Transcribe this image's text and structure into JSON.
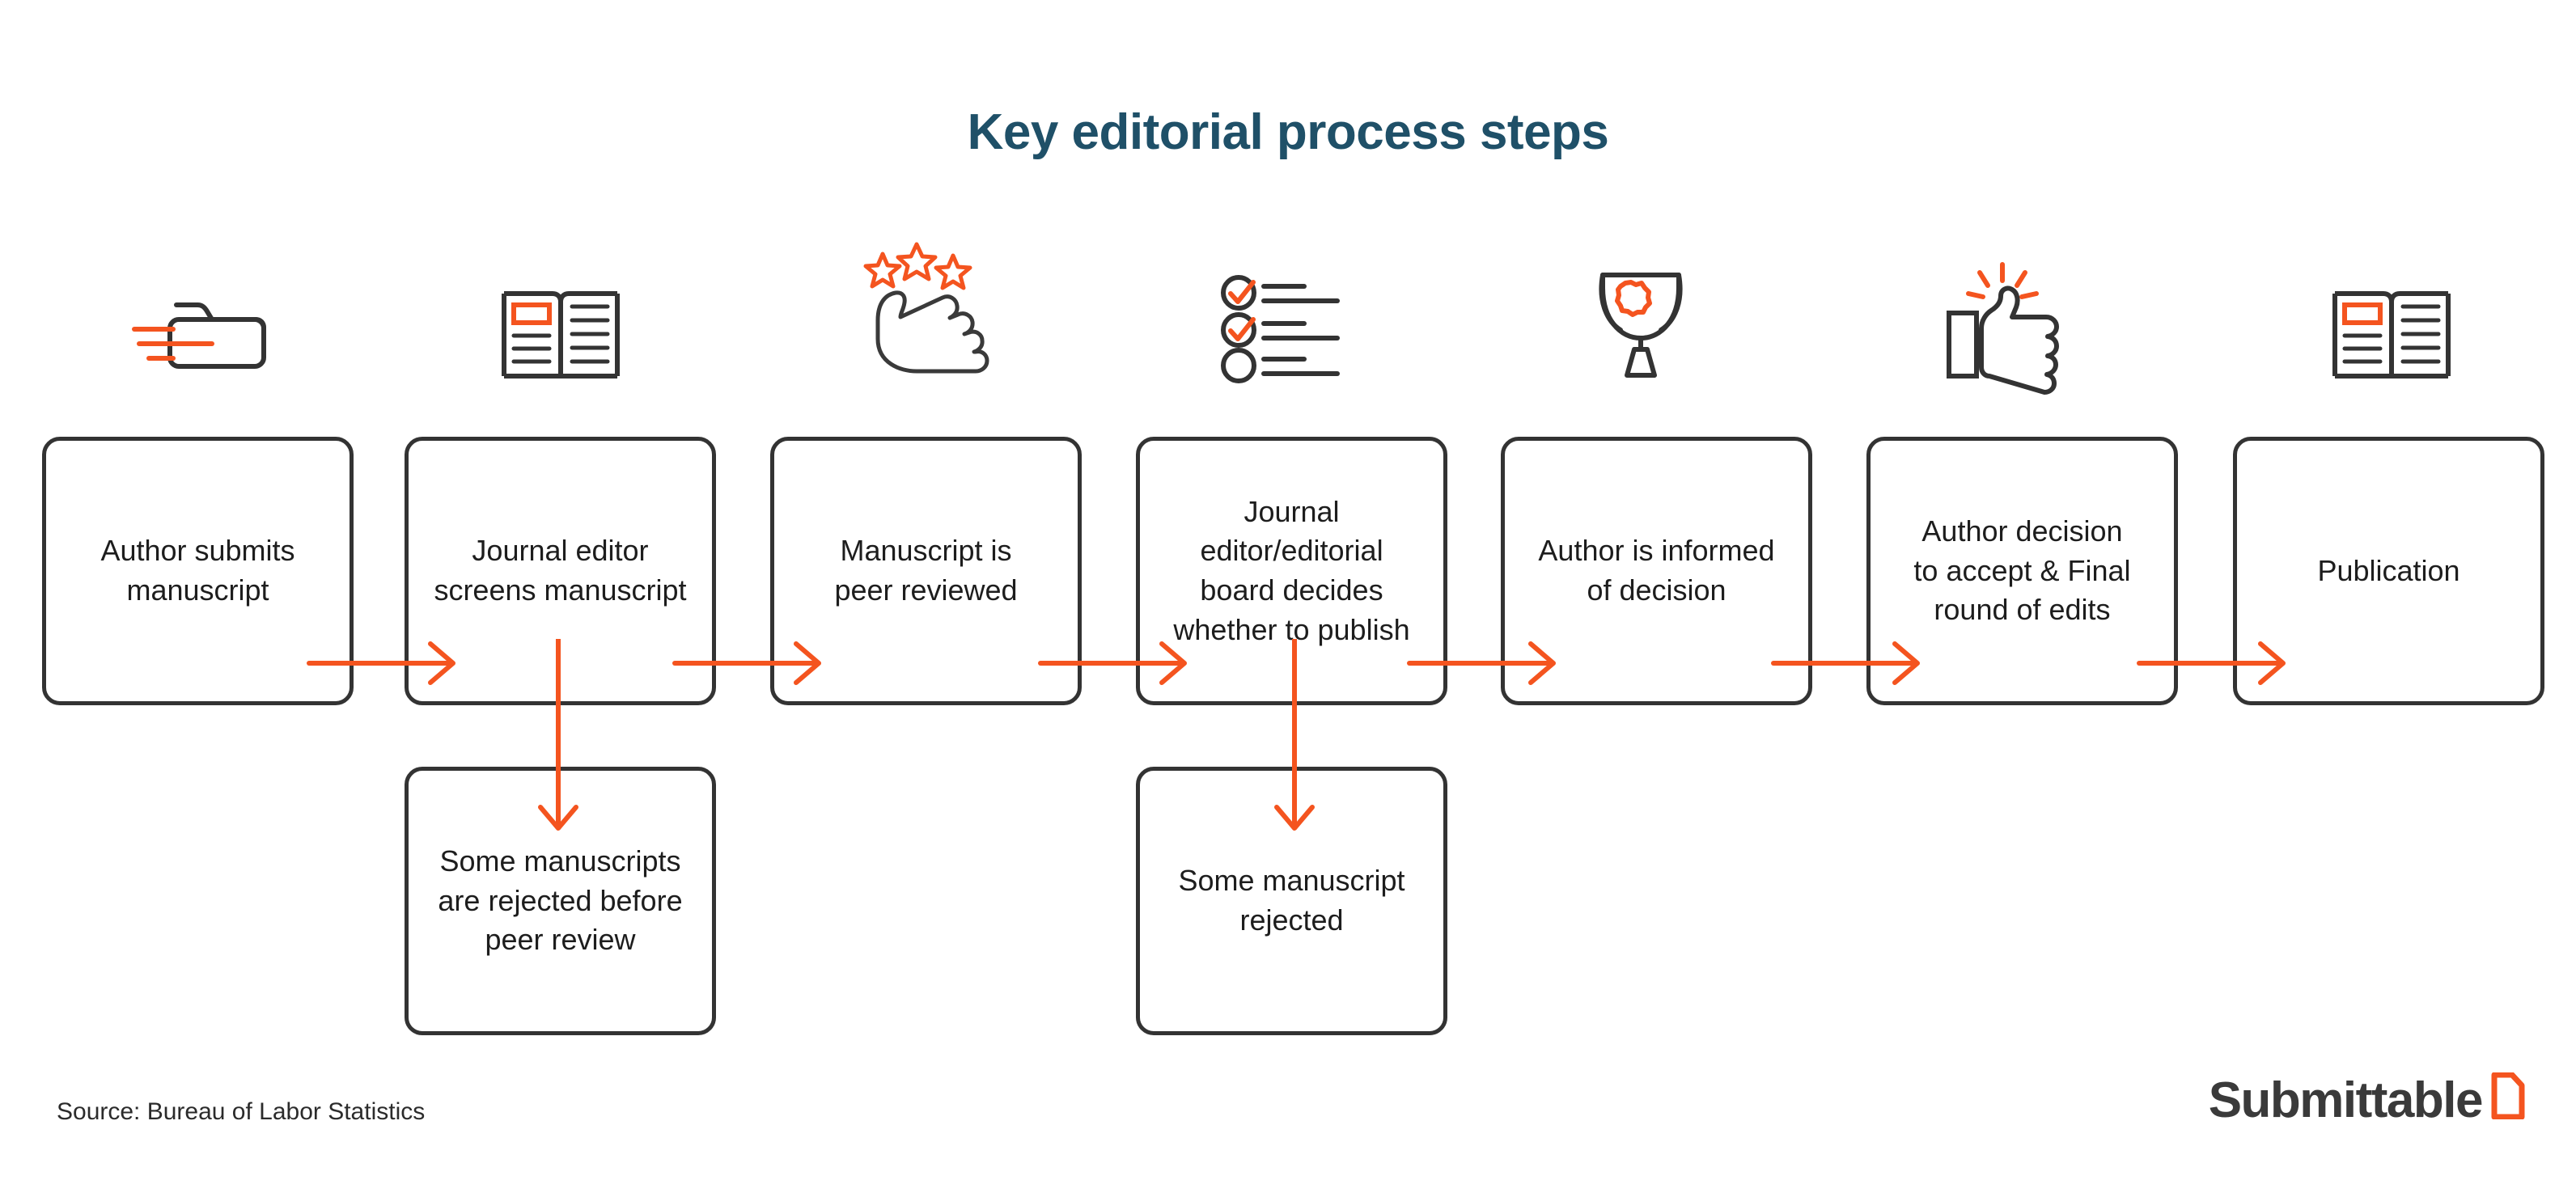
{
  "page": {
    "title": "Key editorial process steps",
    "background_color": "#ffffff",
    "title_color": "#1f5068",
    "accent_color": "#f4541f",
    "line_color": "#333333"
  },
  "steps": [
    {
      "id": "step-1",
      "label": "Author submits\nmanuscript",
      "icon": "folder-upload-icon"
    },
    {
      "id": "step-2",
      "label": "Journal editor\nscreens manuscript",
      "icon": "open-book-icon"
    },
    {
      "id": "step-3",
      "label": "Manuscript is\npeer reviewed",
      "icon": "thumbs-up-stars-icon"
    },
    {
      "id": "step-4",
      "label": "Journal\neditor/editorial\nboard decides\nwhether to publish",
      "icon": "checklist-icon"
    },
    {
      "id": "step-5",
      "label": "Author is informed\nof decision",
      "icon": "trophy-icon"
    },
    {
      "id": "step-6",
      "label": "Author decision\nto accept & Final\nround of edits",
      "icon": "thumbs-up-sparkle-icon"
    },
    {
      "id": "step-7",
      "label": "Publication",
      "icon": "open-book-icon"
    }
  ],
  "branches": [
    {
      "id": "branch-1",
      "label": "Some manuscripts\nare rejected before\npeer review",
      "from_step": "step-2"
    },
    {
      "id": "branch-2",
      "label": "Some manuscript\nrejected",
      "from_step": "step-4"
    }
  ],
  "footer": {
    "source": "Source: Bureau of Labor Statistics",
    "logo_text": "Submittable",
    "logo_mark": "submittable-page-mark-icon"
  }
}
